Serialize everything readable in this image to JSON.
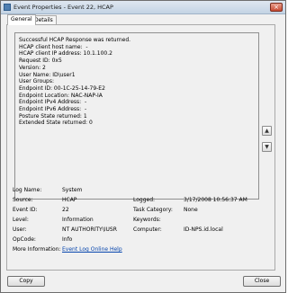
{
  "window": {
    "title": "Event Properties - Event 22, HCAP",
    "close_glyph": "×"
  },
  "tabs": [
    {
      "label": "General",
      "active": true
    },
    {
      "label": "Details",
      "active": false
    }
  ],
  "description": {
    "lines": [
      "Successful HCAP Response was returned.",
      "",
      "HCAP client host name:  -",
      "HCAP client IP address: 10.1.100.2",
      "Request ID: 0x5",
      "Version: 2",
      "User Name: ID\\user1",
      "User Groups:",
      "Endpoint ID: 00-1C-25-14-79-E2",
      "Endpoint Location: NAC-NAP-IA",
      "Endpoint IPv4 Address:  -",
      "Endpoint IPv6 Address:  -",
      "Posture State returned: 1",
      "Extended State returned: 0"
    ]
  },
  "side_buttons": {
    "up_glyph": "▲",
    "down_glyph": "▼"
  },
  "properties": {
    "log_name": {
      "label": "Log Name:",
      "value": "System"
    },
    "source": {
      "label": "Source:",
      "value": "HCAP"
    },
    "logged": {
      "label": "Logged:",
      "value": "3/17/2008 10:56:37 AM"
    },
    "event_id": {
      "label": "Event ID:",
      "value": "22"
    },
    "task_category": {
      "label": "Task Category:",
      "value": "None"
    },
    "level": {
      "label": "Level:",
      "value": "Information"
    },
    "keywords": {
      "label": "Keywords:",
      "value": ""
    },
    "user": {
      "label": "User:",
      "value": "NT AUTHORITY\\IUSR"
    },
    "computer": {
      "label": "Computer:",
      "value": "ID-NPS.id.local"
    },
    "opcode": {
      "label": "OpCode:",
      "value": "Info"
    },
    "more_info": {
      "label": "More Information:",
      "value": "Event Log Online Help"
    }
  },
  "buttons": {
    "copy": "Copy",
    "close": "Close"
  }
}
